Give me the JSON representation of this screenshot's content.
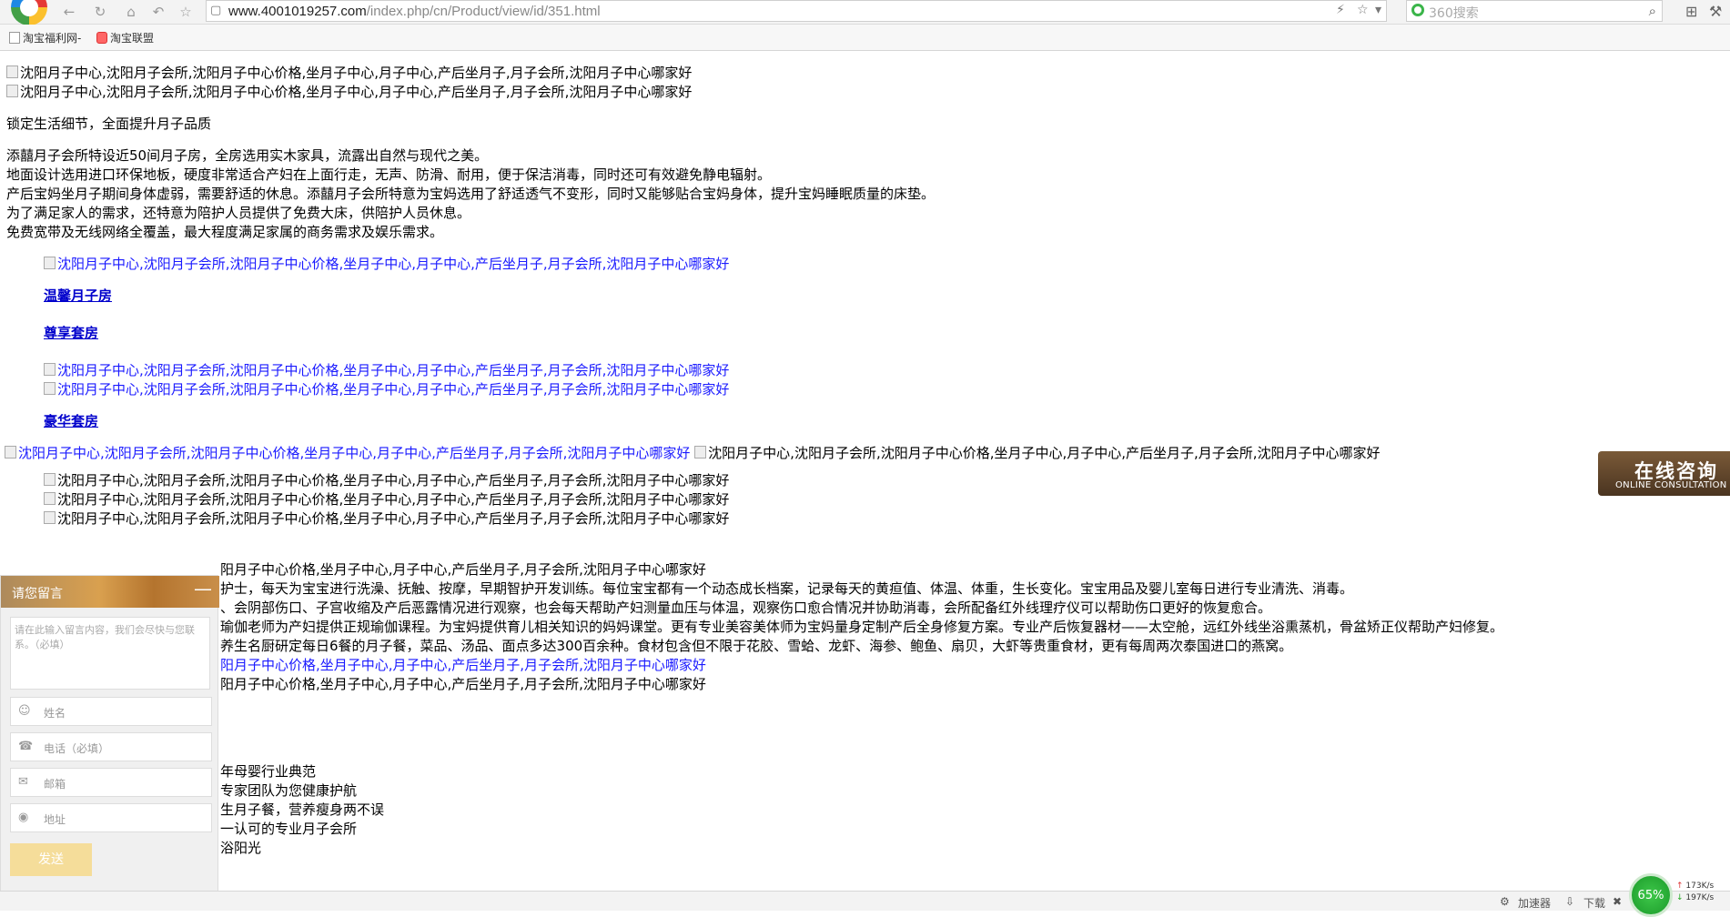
{
  "browser": {
    "url_host": "www.4001019257.com",
    "url_path": "/index.php/cn/Product/view/id/351.html",
    "search_placeholder": "360搜索",
    "bookmarks": [
      "淘宝福利网-",
      "淘宝联盟"
    ]
  },
  "page": {
    "img_alt": "沈阳月子中心,沈阳月子会所,沈阳月子中心价格,坐月子中心,月子中心,产后坐月子,月子会所,沈阳月子中心哪家好",
    "tagline": "锁定生活细节，全面提升月子品质",
    "intro": [
      "添囍月子会所特设近50间月子房，全房选用实木家具，流露出自然与现代之美。",
      "地面设计选用进口环保地板，硬度非常适合产妇在上面行走，无声、防滑、耐用，便于保洁消毒，同时还可有效避免静电辐射。",
      "产后宝妈坐月子期间身体虚弱，需要舒适的休息。添囍月子会所特意为宝妈选用了舒适透气不变形，同时又能够贴合宝妈身体，提升宝妈睡眠质量的床垫。",
      "为了满足家人的需求，还特意为陪护人员提供了免费大床，供陪护人员休息。",
      "免费宽带及无线网络全覆盖，最大程度满足家属的商务需求及娱乐需求。"
    ],
    "room_titles": [
      "温馨月子房",
      "尊享套房",
      "豪华套房"
    ],
    "service_lines": [
      "阳月子中心价格,坐月子中心,月子中心,产后坐月子,月子会所,沈阳月子中心哪家好",
      "护士，每天为宝宝进行洗澡、抚触、按摩，早期智护开发训练。每位宝宝都有一个动态成长档案，记录每天的黄疸值、体温、体重，生长变化。宝宝用品及婴儿室每日进行专业清洗、消毒。",
      "、会阴部伤口、子宫收缩及产后恶露情况进行观察，也会每天帮助产妇测量血压与体温，观察伤口愈合情况并协助消毒，会所配备红外线理疗仪可以帮助伤口更好的恢复愈合。",
      "瑜伽老师为产妇提供正规瑜伽课程。为宝妈提供育儿相关知识的妈妈课堂。更有专业美容美体师为宝妈量身定制产后全身修复方案。专业产后恢复器材——太空舱，远红外线坐浴熏蒸机，骨盆矫正仪帮助产妇修复。",
      "养生名厨研定每日6餐的月子餐，菜品、汤品、面点多达300百余种。食材包含但不限于花胶、雪蛤、龙虾、海参、鲍鱼、扇贝，大虾等贵重食材，更有每周两次泰国进口的燕窝。",
      "阳月子中心价格,坐月子中心,月子中心,产后坐月子,月子会所,沈阳月子中心哪家好",
      "阳月子中心价格,坐月子中心,月子中心,产后坐月子,月子会所,沈阳月子中心哪家好"
    ],
    "bottom_lines": [
      "年母婴行业典范",
      "专家团队为您健康护航",
      "生月子餐，营养瘦身两不误",
      "一认可的专业月子会所",
      "浴阳光"
    ]
  },
  "consult": {
    "title": "在线咨询",
    "subtitle": "ONLINE CONSULTATION"
  },
  "message_panel": {
    "title": "请您留言",
    "minimize": "—",
    "textarea_placeholder": "请在此输入留言内容，我们会尽快与您联系。（必填）",
    "fields": [
      "姓名",
      "电话（必填）",
      "邮箱",
      "地址"
    ],
    "send": "发送"
  },
  "status": {
    "speed_percent": "65%",
    "accelerator": "加速器",
    "download": "下载",
    "up_rate": "173K/s",
    "down_rate": "197K/s"
  }
}
